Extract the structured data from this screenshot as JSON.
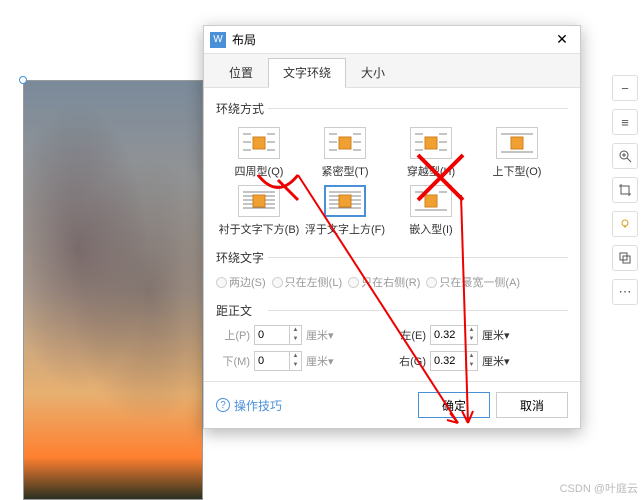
{
  "dialog": {
    "title": "布局",
    "tabs": [
      "位置",
      "文字环绕",
      "大小"
    ],
    "active_tab": 1,
    "section1": {
      "title": "环绕方式",
      "options": [
        {
          "label": "四周型(Q)"
        },
        {
          "label": "紧密型(T)"
        },
        {
          "label": "穿越型(H)"
        },
        {
          "label": "上下型(O)"
        },
        {
          "label": "衬于文字下方(B)"
        },
        {
          "label": "浮于文字上方(F)"
        },
        {
          "label": "嵌入型(I)"
        }
      ]
    },
    "section2": {
      "title": "环绕文字",
      "radios": [
        "两边(S)",
        "只在左侧(L)",
        "只在右侧(R)",
        "只在最宽一侧(A)"
      ]
    },
    "section3": {
      "title": "距正文",
      "rows": [
        {
          "label": "上(P)",
          "value": "0",
          "unit": "厘米",
          "enabled": false
        },
        {
          "label": "左(E)",
          "value": "0.32",
          "unit": "厘米",
          "enabled": true
        },
        {
          "label": "下(M)",
          "value": "0",
          "unit": "厘米",
          "enabled": false
        },
        {
          "label": "右(G)",
          "value": "0.32",
          "unit": "厘米",
          "enabled": true
        }
      ]
    },
    "help": "操作技巧",
    "ok": "确定",
    "cancel": "取消"
  },
  "watermark": "CSDN @叶庭云"
}
